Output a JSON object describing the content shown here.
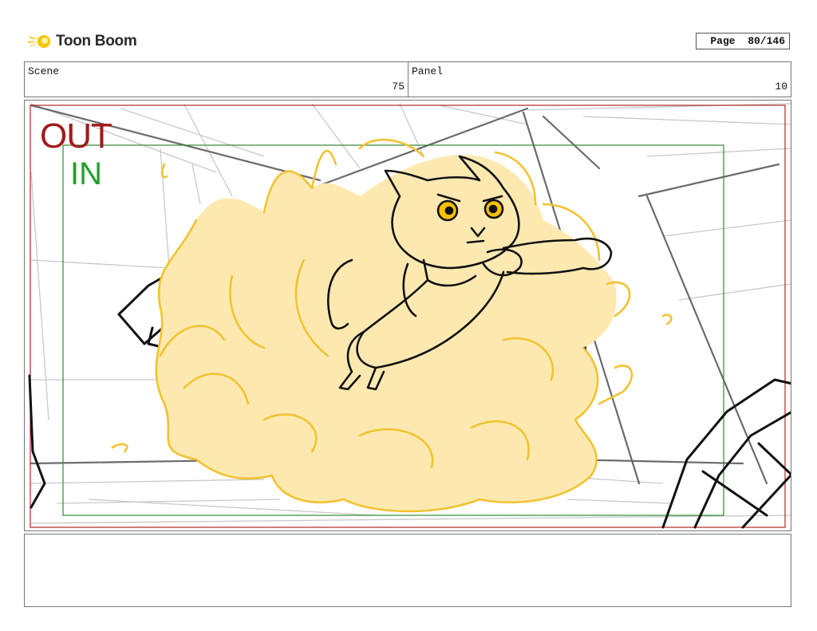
{
  "header": {
    "brand": "Toon Boom",
    "page_label": "Page",
    "page_value": "80/146"
  },
  "scene": {
    "label": "Scene",
    "value": "75"
  },
  "panel": {
    "label": "Panel",
    "value": "10"
  },
  "frame": {
    "out_label": "OUT",
    "in_label": "IN",
    "out_color": "#a21a1a",
    "in_color": "#22a02a",
    "sketch_fill": "#fde9b0",
    "sketch_line": "#f2c230"
  },
  "notes": {
    "text": ""
  }
}
